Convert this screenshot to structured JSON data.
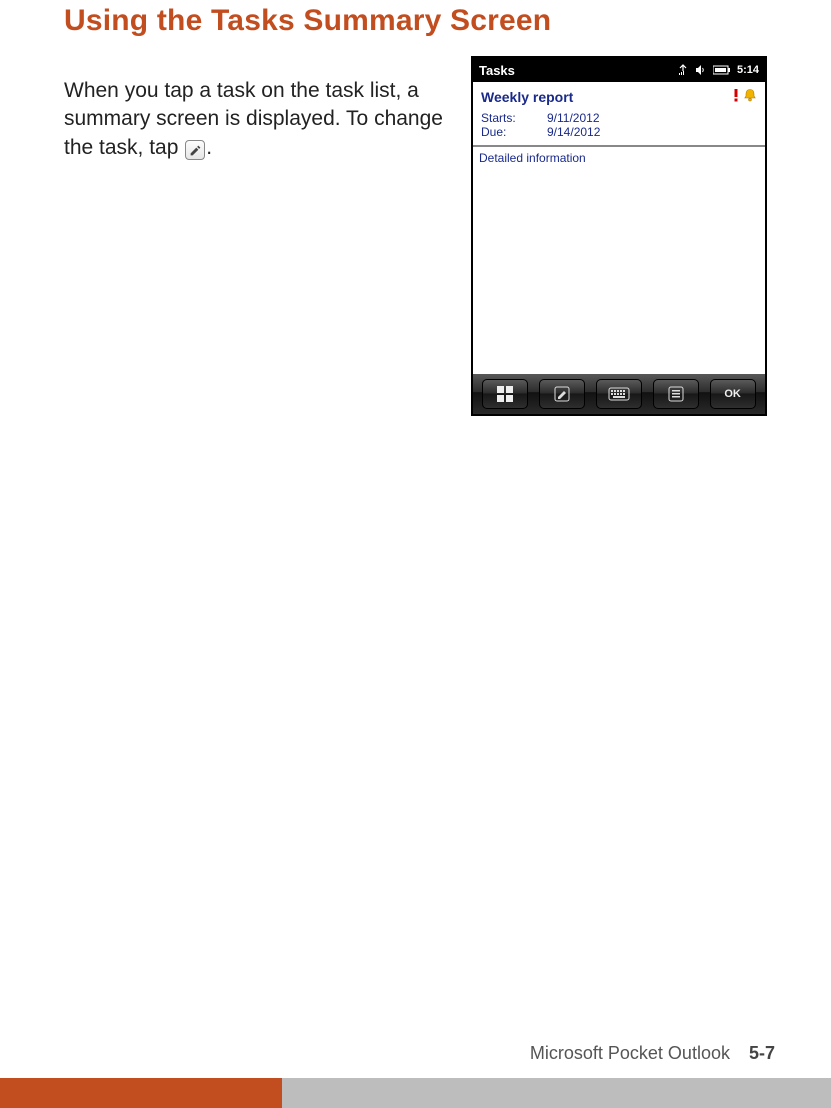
{
  "heading": "Using the Tasks Summary Screen",
  "body_before_icon": "When you tap a task on the task list, a summary screen is displayed. To change the task, tap ",
  "body_after_icon": ".",
  "footer": {
    "title": "Microsoft Pocket Outlook",
    "page": "5-7"
  },
  "device": {
    "titlebar": {
      "app": "Tasks",
      "clock": "5:14"
    },
    "task": {
      "title": "Weekly report",
      "starts_label": "Starts:",
      "starts_value": "9/11/2012",
      "due_label": "Due:",
      "due_value": "9/14/2012"
    },
    "detail": "Detailed information",
    "bottombar": {
      "ok": "OK"
    }
  }
}
